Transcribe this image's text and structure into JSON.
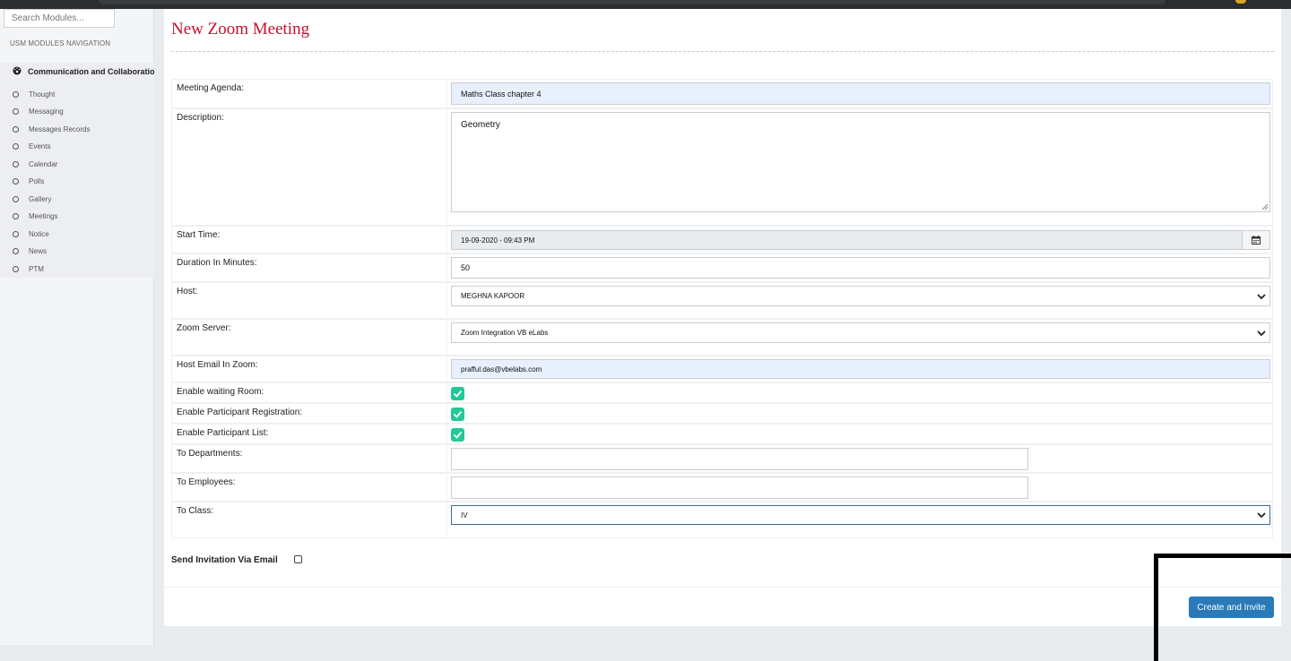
{
  "sidebar": {
    "search_placeholder": "Search Modules...",
    "nav_title": "USM MODULES NAVIGATION",
    "group_label": "Communication and Collaboration",
    "items": [
      "Thought",
      "Messaging",
      "Messages Records",
      "Events",
      "Calendar",
      "Polls",
      "Gallery",
      "Meetings",
      "Notice",
      "News",
      "PTM"
    ]
  },
  "form": {
    "title": "New Zoom Meeting",
    "agenda": {
      "label": "Meeting Agenda:",
      "value": "Maths Class chapter 4"
    },
    "description": {
      "label": "Description:",
      "value": "Geometry"
    },
    "start_time": {
      "label": "Start Time:",
      "value": "19-09-2020 - 09:43 PM"
    },
    "duration": {
      "label": "Duration In Minutes:",
      "value": "50"
    },
    "host": {
      "label": "Host:",
      "value": "MEGHNA KAPOOR"
    },
    "zoom_server": {
      "label": "Zoom Server:",
      "value": "Zoom Integration VB eLabs"
    },
    "host_email": {
      "label": "Host Email In Zoom:",
      "value": "prafful.das@vbelabs.com"
    },
    "waiting_room": {
      "label": "Enable waiting Room:",
      "checked": true
    },
    "participant_registration": {
      "label": "Enable Participant Registration:",
      "checked": true
    },
    "participant_list": {
      "label": "Enable Participant List:",
      "checked": true
    },
    "departments": {
      "label": "To Departments:",
      "value": ""
    },
    "employees": {
      "label": "To Employees:",
      "value": ""
    },
    "to_class": {
      "label": "To Class:",
      "value": "IV"
    },
    "send_invitation": {
      "label": "Send Invitation Via Email",
      "checked": false
    },
    "submit_label": "Create and Invite"
  },
  "colors": {
    "title": "#c8102e",
    "checkbox": "#20c997",
    "button": "#2a7ab8"
  }
}
